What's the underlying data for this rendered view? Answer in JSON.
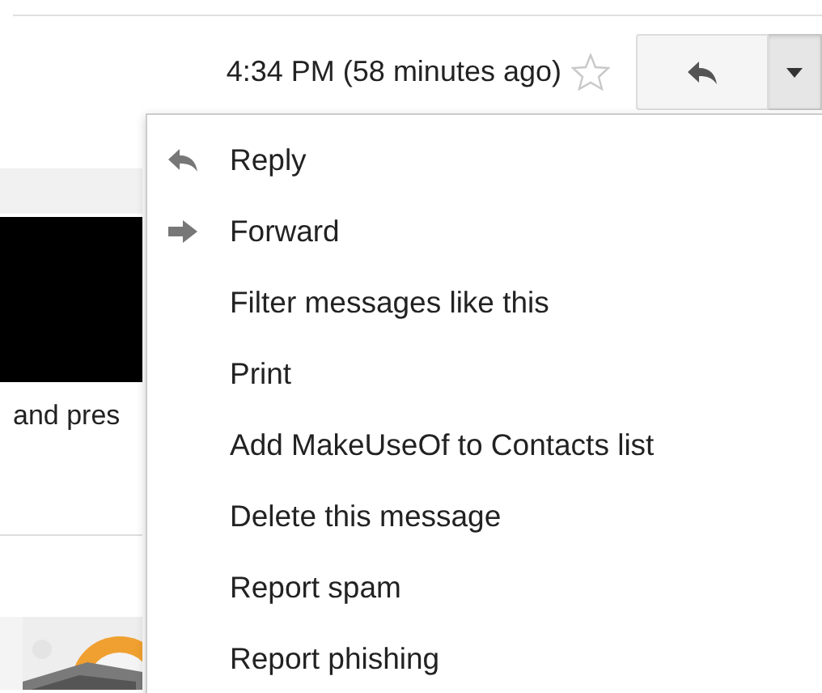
{
  "header": {
    "timestamp": "4:34 PM (58 minutes ago)",
    "starred": false,
    "menu_expanded": true
  },
  "background": {
    "snippet": "and pres"
  },
  "menu": [
    {
      "label": "Reply",
      "kind": "reply"
    },
    {
      "label": "Forward",
      "kind": "forward"
    },
    {
      "label": "Filter messages like this",
      "kind": "plain"
    },
    {
      "label": "Print",
      "kind": "plain"
    },
    {
      "label": "Add MakeUseOf to Contacts list",
      "kind": "plain"
    },
    {
      "label": "Delete this message",
      "kind": "plain"
    },
    {
      "label": "Report spam",
      "kind": "plain"
    },
    {
      "label": "Report phishing",
      "kind": "plain"
    }
  ]
}
